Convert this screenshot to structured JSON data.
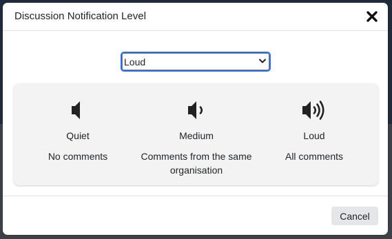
{
  "dialog": {
    "title": "Discussion Notification Level",
    "close_icon": "close-icon"
  },
  "select": {
    "selected": "Loud",
    "options": [
      "Quiet",
      "Medium",
      "Loud"
    ]
  },
  "levels": [
    {
      "icon": "volume-off-icon",
      "name": "Quiet",
      "description": "No comments"
    },
    {
      "icon": "volume-low-icon",
      "name": "Medium",
      "description": "Comments from the same organisation"
    },
    {
      "icon": "volume-high-icon",
      "name": "Loud",
      "description": "All comments"
    }
  ],
  "footer": {
    "cancel_label": "Cancel"
  },
  "colors": {
    "focus_outline": "#2f6fd6",
    "panel_bg": "#f3f3f3",
    "button_bg": "#e5e6e7"
  }
}
